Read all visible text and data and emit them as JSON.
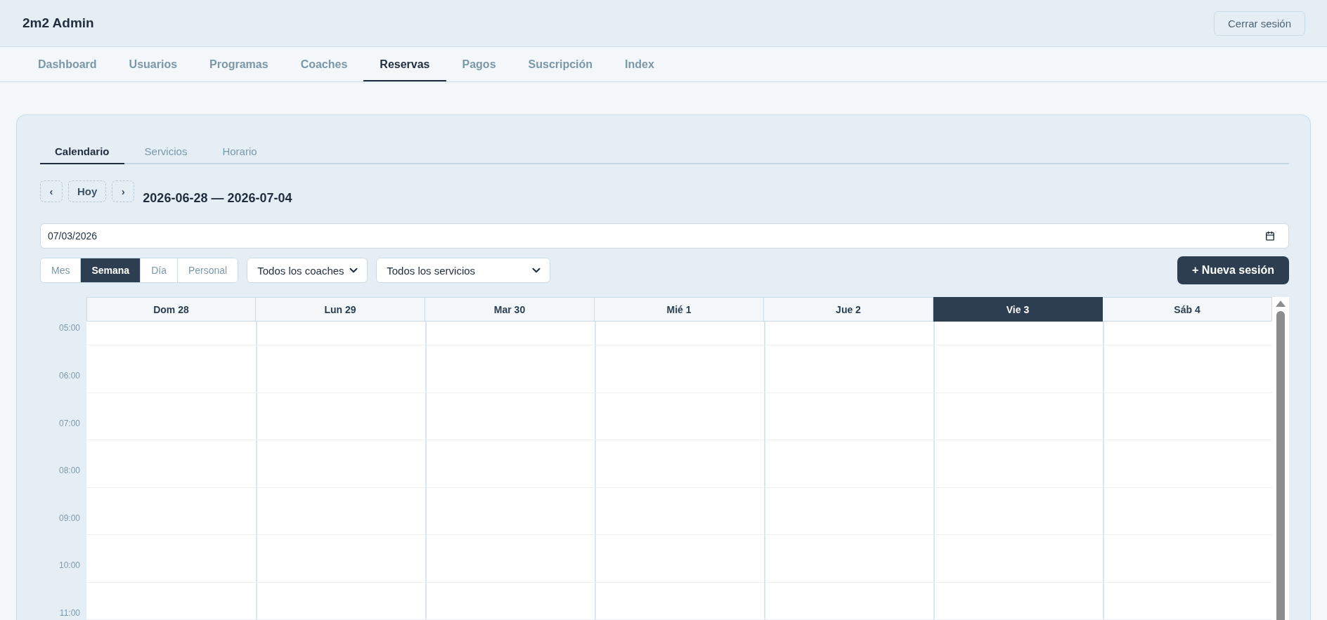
{
  "app": {
    "title": "2m2 Admin",
    "logout_button": "Cerrar sesión"
  },
  "nav": [
    {
      "label": "Dashboard",
      "selected": false
    },
    {
      "label": "Usuarios",
      "selected": false
    },
    {
      "label": "Programas",
      "selected": false
    },
    {
      "label": "Coaches",
      "selected": false
    },
    {
      "label": "Reservas",
      "selected": true
    },
    {
      "label": "Pagos",
      "selected": false
    },
    {
      "label": "Suscripción",
      "selected": false
    },
    {
      "label": "Index",
      "selected": false
    }
  ],
  "subtabs": [
    {
      "label": "Calendario",
      "selected": true
    },
    {
      "label": "Servicios",
      "selected": false
    },
    {
      "label": "Horario",
      "selected": false
    }
  ],
  "toolbar": {
    "prev": "‹",
    "today": "Hoy",
    "next": "›",
    "range": "2026-06-28 — 2026-07-04"
  },
  "date_field": {
    "value": "07/03/2026"
  },
  "views": [
    {
      "label": "Mes",
      "selected": false
    },
    {
      "label": "Semana",
      "selected": true
    },
    {
      "label": "Día",
      "selected": false
    },
    {
      "label": "Personal",
      "selected": false
    }
  ],
  "filters": [
    {
      "value": "Todos los coaches"
    },
    {
      "value": "Todos los servicios"
    }
  ],
  "new_session_button": "+ Nueva sesión",
  "calendar": {
    "days": [
      {
        "label": "Dom 28",
        "today": false
      },
      {
        "label": "Lun 29",
        "today": false
      },
      {
        "label": "Mar 30",
        "today": false
      },
      {
        "label": "Mié 1",
        "today": false
      },
      {
        "label": "Jue 2",
        "today": false
      },
      {
        "label": "Vie 3",
        "today": true
      },
      {
        "label": "Sáb 4",
        "today": false
      }
    ],
    "hours": [
      "05:00",
      "06:00",
      "07:00",
      "08:00",
      "09:00",
      "10:00",
      "11:00"
    ]
  }
}
